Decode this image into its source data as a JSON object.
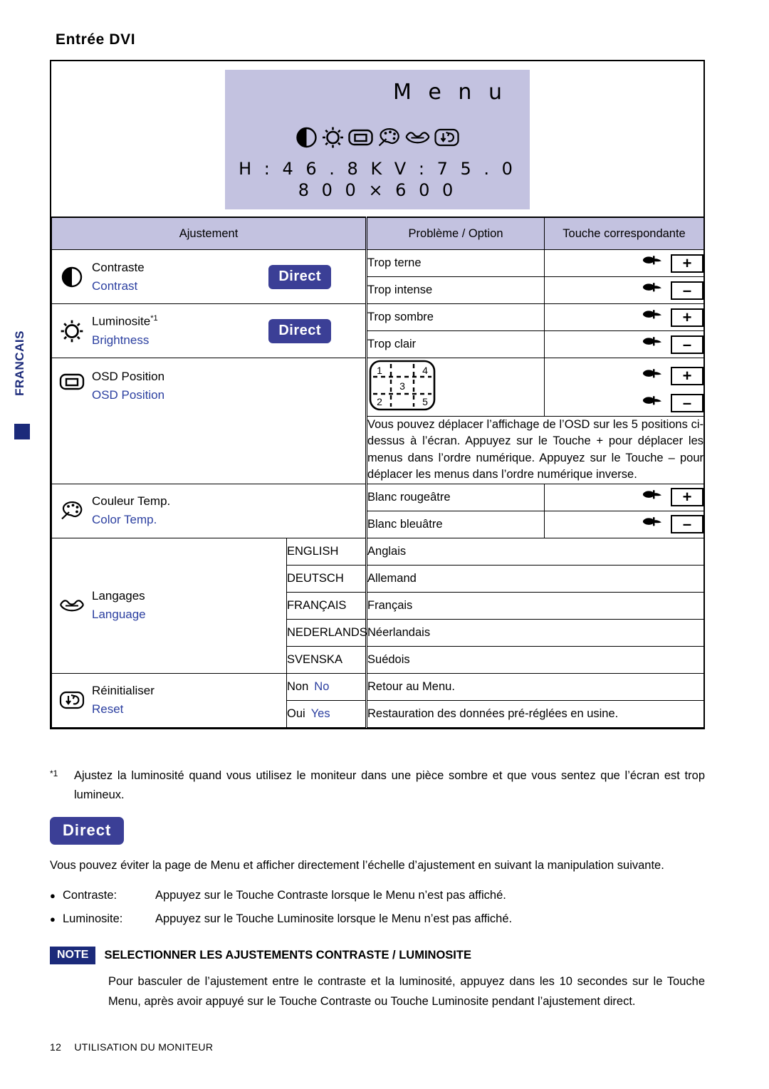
{
  "sidebar": {
    "language_tab": "FRANCAIS"
  },
  "page": {
    "heading": "Entrée DVI"
  },
  "osd": {
    "title": "M e n u",
    "freq_line": "H : 4 6 . 8 K   V : 7 5 . 0",
    "resolution_line": "8 0 0   ×   6 0 0",
    "icons": [
      "contrast-icon",
      "brightness-icon",
      "osd-position-icon",
      "color-temp-icon",
      "language-icon",
      "reset-icon"
    ]
  },
  "table": {
    "headers": {
      "adjustment": "Ajustement",
      "problem_option": "Problème / Option",
      "key": "Touche correspondante"
    },
    "rows": [
      {
        "icon": "contrast-icon",
        "name_fr": "Contraste",
        "name_en": "Contrast",
        "direct": "Direct",
        "problems": [
          "Trop terne",
          "Trop intense"
        ],
        "keys": [
          "+",
          "–"
        ]
      },
      {
        "icon": "brightness-icon",
        "name_fr": "Luminosite",
        "footnote_mark": "*1",
        "name_en": "Brightness",
        "direct": "Direct",
        "problems": [
          "Trop sombre",
          "Trop clair"
        ],
        "keys": [
          "+",
          "–"
        ]
      },
      {
        "icon": "osd-position-icon",
        "name_fr": "OSD Position",
        "name_en": "OSD Position",
        "diagram_numbers": [
          "1",
          "4",
          "3",
          "2",
          "5"
        ],
        "note": "Vous pouvez déplacer l’affichage de l’OSD sur les 5 positions ci-dessus à l’écran. Appuyez sur le Touche + pour déplacer les menus dans l’ordre numérique. Appuyez sur le Touche – pour déplacer les menus dans l’ordre numérique inverse.",
        "keys": [
          "+",
          "–"
        ]
      },
      {
        "icon": "color-temp-icon",
        "name_fr": "Couleur Temp.",
        "name_en": "Color Temp.",
        "problems": [
          "Blanc rougeâtre",
          "Blanc bleuâtre"
        ],
        "keys": [
          "+",
          "–"
        ]
      },
      {
        "icon": "language-icon",
        "name_fr": "Langages",
        "name_en": "Language",
        "options": [
          {
            "value": "ENGLISH",
            "desc": "Anglais"
          },
          {
            "value": "DEUTSCH",
            "desc": "Allemand"
          },
          {
            "value": "FRANÇAIS",
            "desc": "Français"
          },
          {
            "value": "NEDERLANDS",
            "desc": "Néerlandais"
          },
          {
            "value": "SVENSKA",
            "desc": "Suédois"
          }
        ]
      },
      {
        "icon": "reset-icon",
        "name_fr": "Réinitialiser",
        "name_en": "Reset",
        "options": [
          {
            "value_fr": "Non",
            "value_en": "No",
            "desc": "Retour au Menu."
          },
          {
            "value_fr": "Oui",
            "value_en": "Yes",
            "desc": "Restauration des données pré-réglées en usine."
          }
        ]
      }
    ]
  },
  "footnote": {
    "mark": "*1",
    "text": "Ajustez la luminosité quand vous utilisez le moniteur dans une pièce sombre et que vous sentez que l’écran est trop lumineux."
  },
  "direct_section": {
    "badge": "Direct",
    "intro": "Vous pouvez éviter la page de Menu et afficher directement l’échelle d’ajustement en suivant la manipulation suivante.",
    "bullets": [
      {
        "term": "Contraste:",
        "desc": "Appuyez sur le Touche Contraste lorsque le Menu n’est pas affiché."
      },
      {
        "term": "Luminosite:",
        "desc": "Appuyez sur le Touche Luminosite lorsque le Menu n’est pas affiché."
      }
    ]
  },
  "note": {
    "tag": "NOTE",
    "title": "SELECTIONNER LES AJUSTEMENTS CONTRASTE / LUMINOSITE",
    "body": "Pour basculer de l’ajustement entre le contraste et la luminosité, appuyez dans les 10 secondes sur le Touche Menu, après avoir appuyé sur le Touche Contraste ou Touche Luminosite pendant l’ajustement direct."
  },
  "footer": {
    "page_number": "12",
    "section": "UTILISATION DU MONITEUR"
  },
  "colors": {
    "osd_background": "#c3c2e0",
    "accent_blue": "#2b3fa0",
    "badge_blue": "#3b3f96",
    "note_blue": "#1b2a7a"
  }
}
